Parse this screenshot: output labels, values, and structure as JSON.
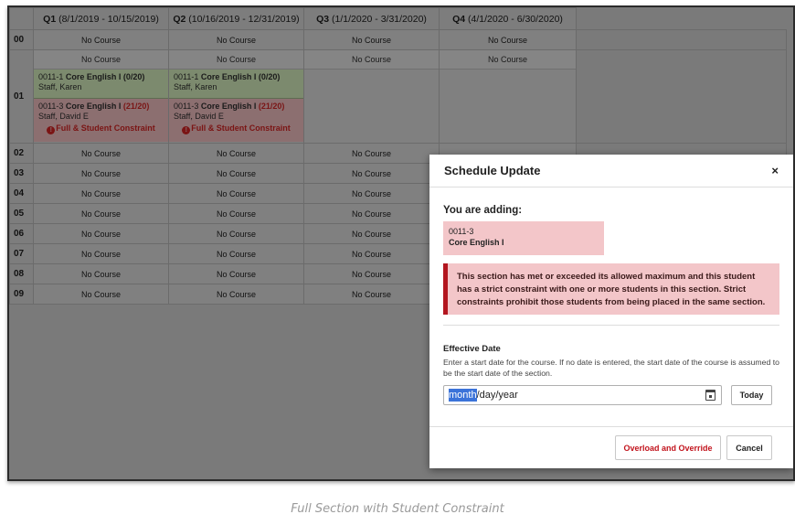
{
  "schedule": {
    "quarters": [
      {
        "name": "Q1",
        "range": "(8/1/2019 - 10/15/2019)"
      },
      {
        "name": "Q2",
        "range": "(10/16/2019 - 12/31/2019)"
      },
      {
        "name": "Q3",
        "range": "(1/1/2020 - 3/31/2020)"
      },
      {
        "name": "Q4",
        "range": "(4/1/2020 - 6/30/2020)"
      }
    ],
    "no_course": "No Course",
    "periods": [
      "00",
      "01",
      "02",
      "03",
      "04",
      "05",
      "06",
      "07",
      "08",
      "09"
    ],
    "period01": {
      "green_section": {
        "code": "0011-1",
        "name": "Core English I",
        "count": "(0/20)",
        "teacher": "Staff, Karen"
      },
      "red_section": {
        "code": "0011-3",
        "name": "Core English I",
        "count": "(21/20)",
        "teacher": "Staff, David E",
        "warning": "Full & Student Constraint"
      }
    }
  },
  "modal": {
    "title": "Schedule Update",
    "close": "×",
    "adding_label": "You are adding:",
    "course_code": "0011-3",
    "course_name": "Core English I",
    "alert": "This section has met or exceeded its allowed maximum and this student has a strict constraint with one or more students in this section. Strict constraints prohibit those students from being placed in the same section.",
    "effective_date_label": "Effective Date",
    "effective_date_help": "Enter a start date for the course. If no date is entered, the start date of the course is assumed to be the start date of the section.",
    "date_month": "month",
    "date_rest": "/day/year",
    "today_button": "Today",
    "override_button": "Overload and Override",
    "cancel_button": "Cancel"
  },
  "caption": "Full Section with Student Constraint",
  "colors": {
    "alert_border": "#b3161f",
    "alert_bg": "#f3c6c9",
    "override_text": "#c2141d"
  }
}
